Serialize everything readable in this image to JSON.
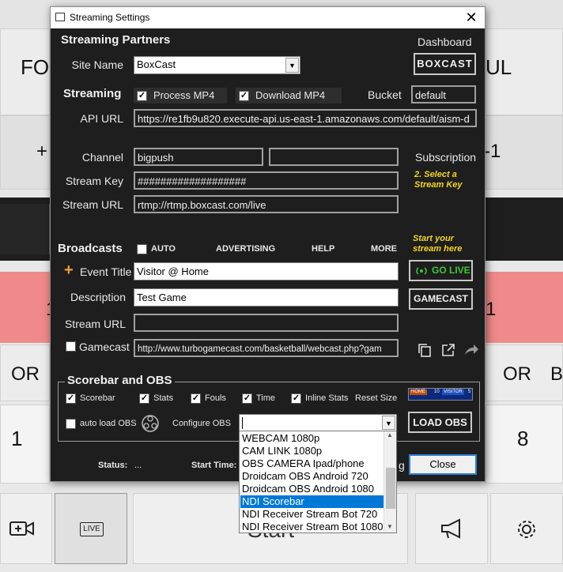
{
  "background": {
    "row1_left": "FO",
    "row1_right": "UL",
    "row2_left": "+",
    "row2_right": "-1",
    "row4_left": "1",
    "row4_right": "1",
    "row5_left": "OR",
    "row5_right": "OR",
    "row5_far_right": "B",
    "row6_left": "1",
    "row6_right": "8",
    "start_label": "Start",
    "live_badge": "LIVE"
  },
  "dialog": {
    "title": "Streaming Settings",
    "close_glyph": "✕",
    "partners": {
      "header": "Streaming Partners",
      "dashboard_label": "Dashboard",
      "site_name_label": "Site Name",
      "site_name_value": "BoxCast",
      "logo_text": "BOXCAST"
    },
    "streaming": {
      "header": "Streaming",
      "process_mp4_label": "Process MP4",
      "process_mp4_checked": true,
      "download_mp4_label": "Download MP4",
      "download_mp4_checked": true,
      "bucket_label": "Bucket",
      "bucket_value": "default",
      "api_url_label": "API URL",
      "api_url_value": "https://re1fb9u820.execute-api.us-east-1.amazonaws.com/default/aism-d"
    },
    "channel": {
      "channel_label": "Channel",
      "channel_value": "bigpush",
      "channel_extra_value": "",
      "subscription_label": "Subscription",
      "stream_key_label": "Stream Key",
      "stream_key_value": "###################",
      "stream_key_hint": "2. Select a Stream Key",
      "stream_url_label": "Stream URL",
      "stream_url_value": "rtmp://rtmp.boxcast.com/live"
    },
    "broadcasts": {
      "header": "Broadcasts",
      "auto_label": "AUTO",
      "auto_checked": false,
      "advertising_label": "ADVERTISING",
      "help_label": "HELP",
      "more_label": "MORE",
      "start_hint": "Start your stream here",
      "plus_glyph": "+",
      "event_title_label": "Event Title",
      "event_title_value": "Visitor @ Home",
      "go_live_label": "GO LIVE",
      "description_label": "Description",
      "description_value": "Test Game",
      "gamecast_button_label": "GAMECAST",
      "stream_url_label": "Stream URL",
      "stream_url_value": "",
      "gamecast_label": "Gamecast",
      "gamecast_checked": false,
      "gamecast_url": "http://www.turbogamecast.com/basketball/webcast.php?gam"
    },
    "scorebar": {
      "header": "Scorebar and OBS",
      "items": [
        {
          "label": "Scorebar",
          "checked": true
        },
        {
          "label": "Stats",
          "checked": true
        },
        {
          "label": "Fouls",
          "checked": true
        },
        {
          "label": "Time",
          "checked": true
        },
        {
          "label": "Inline Stats",
          "checked": true
        }
      ],
      "reset_size_label": "Reset  Size",
      "preview_home": "HOME",
      "preview_home_score": "10",
      "preview_visitor": "VISITOR",
      "preview_visitor_score": "5",
      "auto_load_obs_label": "auto load OBS",
      "auto_load_obs_checked": false,
      "configure_obs_label": "Configure OBS",
      "configure_obs_value": "",
      "load_obs_label": "LOAD OBS"
    },
    "status": {
      "status_label": "Status:",
      "status_value": "...",
      "start_time_label": "Start Time:",
      "partial_text": "g",
      "close_button_label": "Close"
    },
    "obs_dropdown": {
      "options": [
        "WEBCAM 1080p",
        "CAM LINK 1080p",
        "OBS CAMERA Ipad/phone",
        "Droidcam OBS Android 720",
        "Droidcam OBS Android 1080",
        "NDI Scorebar",
        "NDI Receiver Stream Bot 720",
        "NDI Receiver Stream Bot 1080"
      ],
      "selected_index": 5
    }
  },
  "colors": {
    "dialog_bg": "#1e1e1e",
    "highlight": "#0078d7",
    "go_live_green": "#39c839",
    "hint_yellow": "#f5d623",
    "accent_orange": "#f0a030"
  }
}
